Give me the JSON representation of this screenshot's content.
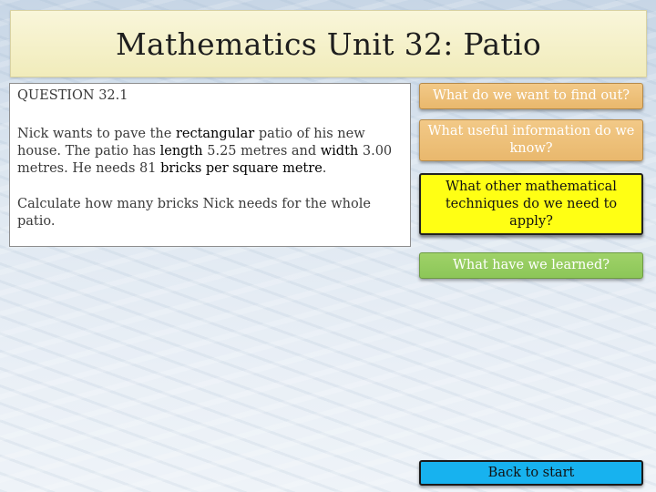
{
  "slide": {
    "title": "Mathematics Unit 32: Patio"
  },
  "question": {
    "heading": "QUESTION 32.1",
    "para1": {
      "t1": "Nick wants to pave the ",
      "k1": "rectangular",
      "t2": " patio of his new house.  The patio has ",
      "k2": "length",
      "t3": " 5.25 metres and ",
      "k3": "width",
      "t4": " 3.00 metres.  He needs 81 ",
      "k4": "bricks per square metre",
      "t5": "."
    },
    "para2": "Calculate how many bricks Nick needs for the whole patio."
  },
  "prompts": {
    "find_out": "What do we want to find out?",
    "useful_info": "What useful information do we know?",
    "techniques": "What other mathematical techniques do we need to apply?",
    "learned": "What have we learned?"
  },
  "nav": {
    "back_label": "Back to start"
  }
}
